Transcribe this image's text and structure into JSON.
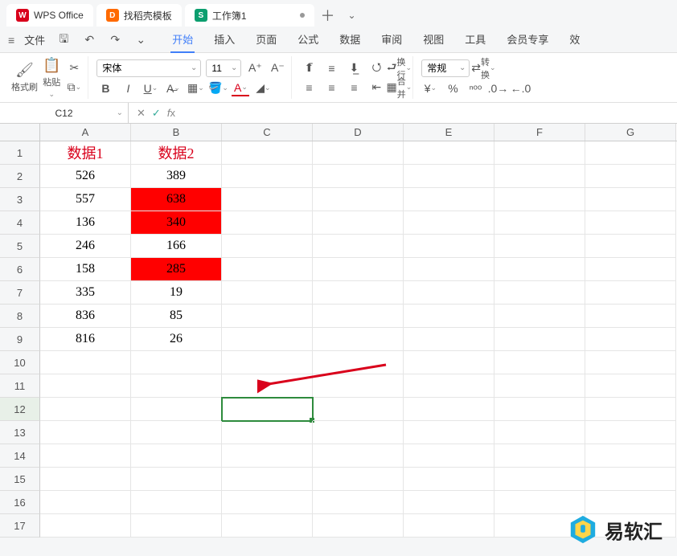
{
  "tabs": {
    "app": "WPS Office",
    "template": "找稻壳模板",
    "doc": "工作簿1"
  },
  "menu": {
    "file": "文件",
    "items": [
      "开始",
      "插入",
      "页面",
      "公式",
      "数据",
      "审阅",
      "视图",
      "工具",
      "会员专享",
      "效"
    ]
  },
  "ribbon": {
    "format_painter": "格式刷",
    "paste": "粘贴",
    "font_name": "宋体",
    "font_size": "11",
    "wrap": "换行",
    "merge": "合并",
    "num_format": "常规",
    "convert": "转换"
  },
  "fx": {
    "cellref": "C12",
    "formula": ""
  },
  "chart_data": {
    "type": "table",
    "columns": [
      "A",
      "B",
      "C",
      "D",
      "E",
      "F",
      "G"
    ],
    "headers": [
      "数据1",
      "数据2"
    ],
    "rows": [
      {
        "a": "526",
        "b": "389",
        "hl": false
      },
      {
        "a": "557",
        "b": "638",
        "hl": true
      },
      {
        "a": "136",
        "b": "340",
        "hl": true
      },
      {
        "a": "246",
        "b": "166",
        "hl": false
      },
      {
        "a": "158",
        "b": "285",
        "hl": true
      },
      {
        "a": "335",
        "b": "19",
        "hl": false
      },
      {
        "a": "836",
        "b": "85",
        "hl": false
      },
      {
        "a": "816",
        "b": "26",
        "hl": false
      }
    ],
    "selected_cell": "C12"
  },
  "watermark": "易软汇"
}
